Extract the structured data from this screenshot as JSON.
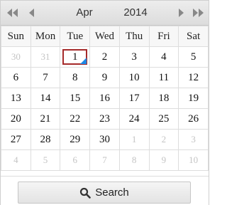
{
  "header": {
    "month": "Apr",
    "year": "2014",
    "prev_year_icon": "double-chevron-left-icon",
    "prev_month_icon": "chevron-left-icon",
    "next_month_icon": "chevron-right-icon",
    "next_year_icon": "double-chevron-right-icon"
  },
  "weekdays": [
    "Sun",
    "Mon",
    "Tue",
    "Wed",
    "Thu",
    "Fri",
    "Sat"
  ],
  "weeks": [
    [
      "30",
      "31",
      "1",
      "2",
      "3",
      "4",
      "5"
    ],
    [
      "6",
      "7",
      "8",
      "9",
      "10",
      "11",
      "12"
    ],
    [
      "13",
      "14",
      "15",
      "16",
      "17",
      "18",
      "19"
    ],
    [
      "20",
      "21",
      "22",
      "23",
      "24",
      "25",
      "26"
    ],
    [
      "27",
      "28",
      "29",
      "30",
      "1",
      "2",
      "3"
    ],
    [
      "4",
      "5",
      "6",
      "7",
      "8",
      "9",
      "10"
    ]
  ],
  "colors": {
    "selected_border": "#a52a2a",
    "selected_corner": "#1e88e5",
    "other_month_text": "#c4c4c4"
  },
  "footer": {
    "search_label": "Search",
    "search_icon": "magnifier-icon"
  }
}
